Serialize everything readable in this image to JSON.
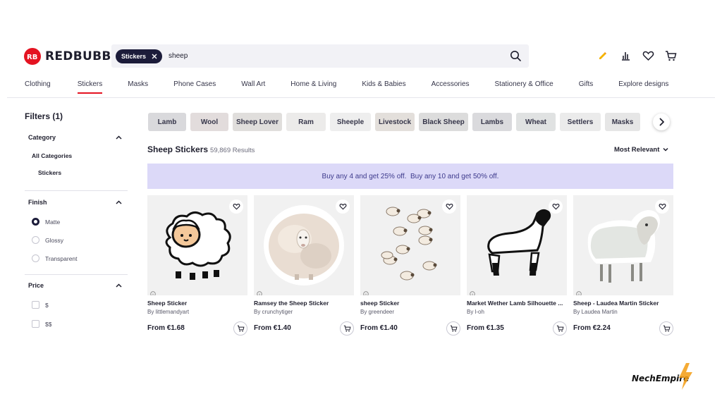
{
  "header": {
    "logo_text": "REDBUBBLE",
    "search_chip": "Stickers",
    "search_value": "sheep"
  },
  "nav": [
    "Clothing",
    "Stickers",
    "Masks",
    "Phone Cases",
    "Wall Art",
    "Home & Living",
    "Kids & Babies",
    "Accessories",
    "Stationery & Office",
    "Gifts",
    "Explore designs"
  ],
  "nav_active": "Stickers",
  "sidebar": {
    "title": "Filters (1)",
    "category": {
      "label": "Category",
      "items": [
        "All Categories",
        "Stickers"
      ]
    },
    "finish": {
      "label": "Finish",
      "options": [
        "Matte",
        "Glossy",
        "Transparent"
      ],
      "selected": "Matte"
    },
    "price": {
      "label": "Price",
      "options": [
        "$",
        "$$"
      ]
    }
  },
  "pills": [
    {
      "label": "Lamb",
      "bg": "#d9d9dc"
    },
    {
      "label": "Wool",
      "bg": "#e2dcdc"
    },
    {
      "label": "Sheep Lover",
      "bg": "#e0dedc"
    },
    {
      "label": "Ram",
      "bg": "#ecebea"
    },
    {
      "label": "Sheeple",
      "bg": "#eeeeee"
    },
    {
      "label": "Livestock",
      "bg": "#e3dfdb"
    },
    {
      "label": "Black Sheep",
      "bg": "#dcdcdc"
    },
    {
      "label": "Lambs",
      "bg": "#dadadd"
    },
    {
      "label": "Wheat",
      "bg": "#e0e2e2"
    },
    {
      "label": "Settlers",
      "bg": "#ebebeb"
    },
    {
      "label": "Masks",
      "bg": "#e6e6e6"
    }
  ],
  "results": {
    "title": "Sheep Stickers",
    "count": "59,869 Results",
    "sort": "Most Relevant"
  },
  "promo": "Buy any 4 and get 25% off.  Buy any 10 and get 50% off.",
  "products": [
    {
      "title": "Sheep Sticker",
      "by": "By littlemandyart",
      "price": "From €1.68"
    },
    {
      "title": "Ramsey the Sheep Sticker",
      "by": "By crunchytiger",
      "price": "From €1.40"
    },
    {
      "title": "sheep Sticker",
      "by": "By greendeer",
      "price": "From €1.40"
    },
    {
      "title": "Market Wether Lamb Silhouette ...",
      "by": "By l-oh",
      "price": "From €1.35"
    },
    {
      "title": "Sheep - Laudea Martin Sticker",
      "by": "By Laudea Martin",
      "price": "From €2.24"
    }
  ],
  "watermark": "NechEmpire",
  "colors": {
    "brand": "#e41321",
    "accent_navy": "#1c1c3a",
    "promo_bg": "#dcd9f8",
    "promo_text": "#3d3a8c"
  }
}
